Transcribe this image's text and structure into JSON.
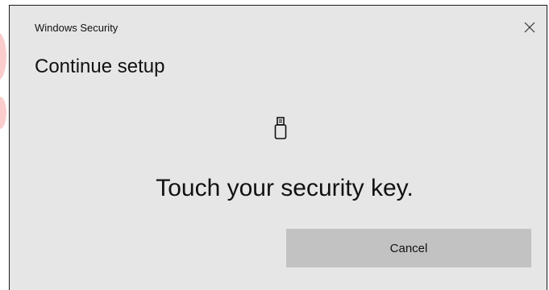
{
  "dialog": {
    "title": "Windows Security",
    "heading": "Continue setup",
    "message": "Touch your security key.",
    "cancel_label": "Cancel",
    "close_icon": "close-icon",
    "key_icon": "usb-security-key-icon"
  },
  "colors": {
    "dialog_background": "#e6e6e6",
    "button_background": "#c2c2c2",
    "border": "#1a1a1a",
    "text": "#111111"
  }
}
